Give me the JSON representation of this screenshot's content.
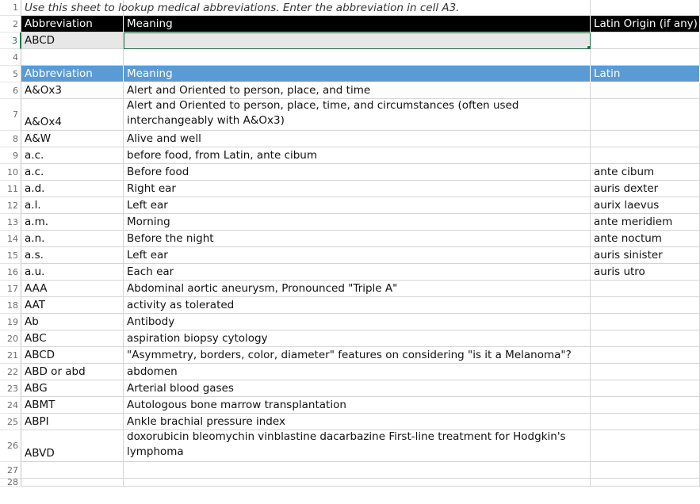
{
  "instruction": "Use this sheet to lookup medical abbreviations. Enter the abbreviation in cell A3.",
  "lookup_header": {
    "abbreviation": "Abbreviation",
    "meaning": "Meaning",
    "latin": "Latin Origin (if any)"
  },
  "lookup_input": {
    "abbreviation": "ABCD",
    "meaning": "",
    "latin": ""
  },
  "table_header": {
    "abbreviation": "Abbreviation",
    "meaning": "Meaning",
    "latin": "Latin"
  },
  "table_rows": [
    {
      "abbreviation": "A&Ox3",
      "meaning": "Alert and Oriented to person, place, and time",
      "latin": ""
    },
    {
      "abbreviation": "A&Ox4",
      "meaning": "Alert and Oriented to person, place, time, and circumstances (often used interchangeably with A&Ox3)",
      "latin": ""
    },
    {
      "abbreviation": "A&W",
      "meaning": "Alive and well",
      "latin": ""
    },
    {
      "abbreviation": "a.c.",
      "meaning": "before food, from Latin, ante cibum",
      "latin": ""
    },
    {
      "abbreviation": "a.c.",
      "meaning": "Before food",
      "latin": "ante cibum"
    },
    {
      "abbreviation": "a.d.",
      "meaning": "Right ear",
      "latin": "auris dexter"
    },
    {
      "abbreviation": "a.l.",
      "meaning": "Left ear",
      "latin": "aurix laevus"
    },
    {
      "abbreviation": "a.m.",
      "meaning": "Morning",
      "latin": "ante meridiem"
    },
    {
      "abbreviation": "a.n.",
      "meaning": "Before the night",
      "latin": "ante noctum"
    },
    {
      "abbreviation": "a.s.",
      "meaning": "Left ear",
      "latin": "auris sinister"
    },
    {
      "abbreviation": "a.u.",
      "meaning": "Each ear",
      "latin": "auris utro"
    },
    {
      "abbreviation": "AAA",
      "meaning": "Abdominal aortic aneurysm, Pronounced \"Triple A\"",
      "latin": ""
    },
    {
      "abbreviation": "AAT",
      "meaning": "activity as tolerated",
      "latin": ""
    },
    {
      "abbreviation": "Ab",
      "meaning": "Antibody",
      "latin": ""
    },
    {
      "abbreviation": "ABC",
      "meaning": "aspiration biopsy cytology",
      "latin": ""
    },
    {
      "abbreviation": "ABCD",
      "meaning": "\"Asymmetry, borders, color, diameter\" features on considering \"is it a Melanoma\"?",
      "latin": ""
    },
    {
      "abbreviation": "ABD or abd",
      "meaning": "abdomen",
      "latin": ""
    },
    {
      "abbreviation": "ABG",
      "meaning": "Arterial blood gases",
      "latin": ""
    },
    {
      "abbreviation": "ABMT",
      "meaning": "Autologous bone marrow transplantation",
      "latin": ""
    },
    {
      "abbreviation": "ABPI",
      "meaning": "Ankle brachial pressure index",
      "latin": ""
    },
    {
      "abbreviation": "ABVD",
      "meaning": "doxorubicin bleomychin vinblastine dacarbazine First-line treatment for Hodgkin's lymphoma",
      "latin": ""
    }
  ],
  "row_numbers": [
    "1",
    "2",
    "3",
    "4",
    "5",
    "6",
    "7",
    "8",
    "9",
    "10",
    "11",
    "12",
    "13",
    "14",
    "15",
    "16",
    "17",
    "18",
    "19",
    "20",
    "21",
    "22",
    "23",
    "24",
    "25",
    "26",
    "27",
    "28"
  ],
  "colors": {
    "black_header": "#000000",
    "blue_header": "#5b9bd5",
    "grey_row": "#e7e7e7",
    "selection": "#217346"
  }
}
